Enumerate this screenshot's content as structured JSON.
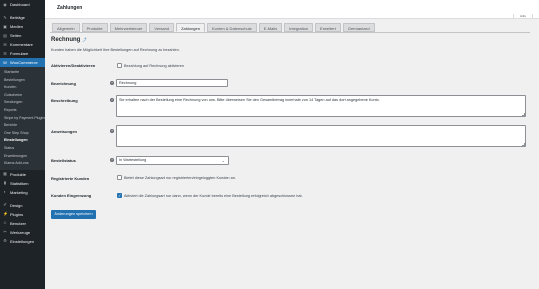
{
  "sidebar": {
    "items_top": [
      {
        "label": "Dashboard",
        "icon": "dashboard-icon",
        "glyph": "◉"
      },
      {
        "label": "Beiträge",
        "icon": "pin-icon",
        "glyph": "✎"
      },
      {
        "label": "Medien",
        "icon": "media-icon",
        "glyph": "▣"
      },
      {
        "label": "Seiten",
        "icon": "page-icon",
        "glyph": "▤"
      },
      {
        "label": "Kommentare",
        "icon": "comment-icon",
        "glyph": "✉"
      },
      {
        "label": "Formulare",
        "icon": "form-icon",
        "glyph": "☰"
      }
    ],
    "woocommerce": {
      "label": "WooCommerce",
      "icon": "woocommerce-icon",
      "glyph": "W"
    },
    "sub_items": [
      "Startseite",
      "Bestellungen",
      "Kunden",
      "Gutscheine",
      "Sendungen",
      "Reports",
      "Stripe by Payment Plugins",
      "Berichte",
      "One Step Shop",
      "Einstellungen",
      "Status",
      "Erweiterungen",
      "Klarna Add-ons"
    ],
    "current_sub": "Einstellungen",
    "items_bottom": [
      {
        "label": "Produkte",
        "icon": "products-icon",
        "glyph": "▦"
      },
      {
        "label": "Statistiken",
        "icon": "stats-icon",
        "glyph": "▮"
      },
      {
        "label": "Marketing",
        "icon": "megaphone-icon",
        "glyph": "◐"
      }
    ],
    "items_bottom2": [
      {
        "label": "Design",
        "icon": "brush-icon",
        "glyph": "✐"
      },
      {
        "label": "Plugins",
        "icon": "plugin-icon",
        "glyph": "⚡"
      },
      {
        "label": "Benutzer",
        "icon": "users-icon",
        "glyph": "☺"
      },
      {
        "label": "Werkzeuge",
        "icon": "tools-icon",
        "glyph": "✂"
      },
      {
        "label": "Einstellungen",
        "icon": "settings-icon",
        "glyph": "⚙"
      }
    ]
  },
  "header": {
    "title": "Zahlungen",
    "help": "Hilfe"
  },
  "tabs": [
    {
      "label": "Allgemein",
      "active": false
    },
    {
      "label": "Produkte",
      "active": false
    },
    {
      "label": "Mehrwertsteuer",
      "active": false
    },
    {
      "label": "Versand",
      "active": false
    },
    {
      "label": "Zahlungen",
      "active": true
    },
    {
      "label": "Konten & Datenschutz",
      "active": false
    },
    {
      "label": "E-Mails",
      "active": false
    },
    {
      "label": "Integration",
      "active": false
    },
    {
      "label": "Erweitert",
      "active": false
    },
    {
      "label": "Germanized",
      "active": false
    }
  ],
  "section": {
    "title": "Rechnung",
    "up_link": "⤴",
    "description": "Kunden haben die Möglichkeit Ihre Bestellungen auf Rechnung zu bezahlen."
  },
  "fields": {
    "enable": {
      "label": "Aktivieren/Deaktivieren",
      "text": "Bezahlung auf Rechnung aktivieren",
      "checked": false
    },
    "title": {
      "label": "Bezeichnung",
      "value": "Rechnung"
    },
    "description": {
      "label": "Beschreibung",
      "value": "Sie erhalten nach der Bestellung eine Rechnung von uns. Bitte überweisen Sie den Gesamtbetrag innerhalb von 14 Tagen auf das dort angegebene Konto."
    },
    "instructions": {
      "label": "Anweisungen",
      "value": ""
    },
    "order_status": {
      "label": "Bestellstatus",
      "value": "In Wartestellung"
    },
    "registered": {
      "label": "Registrierte Kunden",
      "text": "Bietet diese Zahlungsart nur registrierten/eingeloggten Kunden an.",
      "checked": false
    },
    "enforce": {
      "label": "Kunden Eingrenzung",
      "text": "Aktiviert die Zahlungsart nur dann, wenn der Kunde bereits eine Bestellung erfolgreich abgeschlossen hat.",
      "checked": true
    }
  },
  "save_label": "Änderungen speichern",
  "colors": {
    "accent": "#2271b1",
    "sidebar": "#1d2327",
    "background": "#f0f0f1"
  }
}
